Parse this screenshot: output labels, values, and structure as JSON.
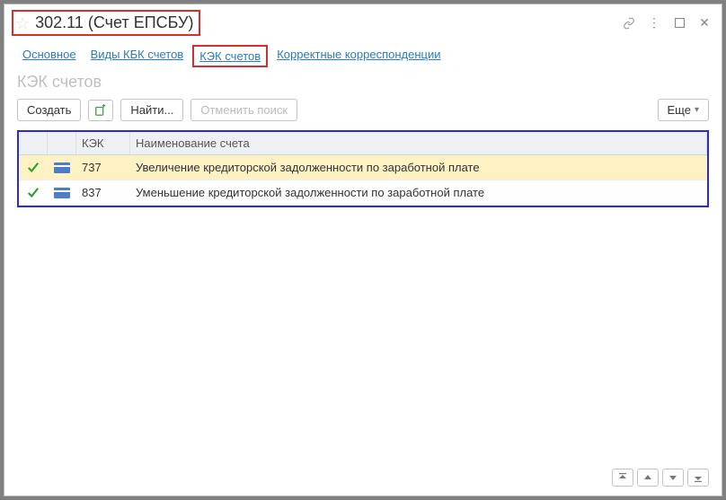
{
  "window": {
    "title": "302.11 (Счет ЕПСБУ)"
  },
  "tabs": [
    {
      "label": "Основное"
    },
    {
      "label": "Виды КБК счетов"
    },
    {
      "label": "КЭК счетов"
    },
    {
      "label": "Корректные корреспонденции"
    }
  ],
  "section_title": "КЭК счетов",
  "toolbar": {
    "create": "Создать",
    "find": "Найти...",
    "cancel_search": "Отменить поиск",
    "more": "Еще"
  },
  "columns": {
    "code": "КЭК",
    "name": "Наименование счета"
  },
  "rows": [
    {
      "code": "737",
      "name": "Увеличение кредиторской задолженности по заработной плате",
      "selected": true
    },
    {
      "code": "837",
      "name": "Уменьшение кредиторской задолженности по заработной плате",
      "selected": false
    }
  ]
}
